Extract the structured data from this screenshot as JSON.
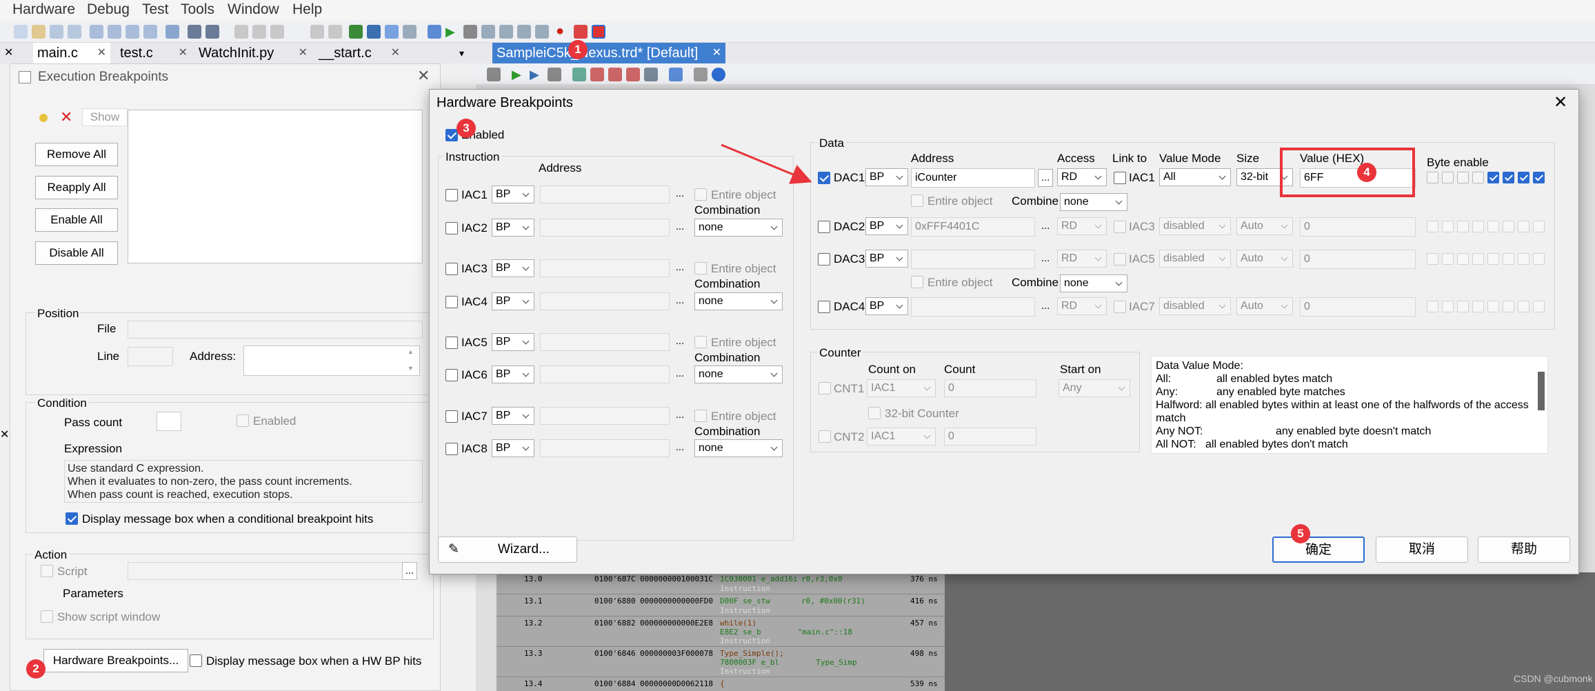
{
  "menu": [
    "Hardware",
    "Debug",
    "Test",
    "Tools",
    "Window",
    "Help"
  ],
  "tabs": [
    {
      "label": "main.c"
    },
    {
      "label": "test.c"
    },
    {
      "label": "WatchInit.py"
    },
    {
      "label": "__start.c"
    }
  ],
  "right_tab": "SampleiC5k_Nexus.trd* [Default]",
  "exec": {
    "title": "Execution Breakpoints",
    "show": "Show",
    "remove_all": "Remove All",
    "reapply_all": "Reapply All",
    "enable_all": "Enable All",
    "disable_all": "Disable All",
    "position": "Position",
    "file": "File",
    "line": "Line",
    "address": "Address:",
    "condition": "Condition",
    "pass_count": "Pass count",
    "enabled": "Enabled",
    "expression": "Expression",
    "expr_help": [
      "Use standard C expression.",
      "When it evaluates to non-zero, the pass count increments.",
      "When pass count is reached, execution stops."
    ],
    "display_msg": "Display message box when a conditional breakpoint hits",
    "action": "Action",
    "script": "Script",
    "parameters": "Parameters",
    "show_script": "Show script window",
    "hw_button": "Hardware Breakpoints...",
    "hw_msg": "Display message box when a HW BP hits"
  },
  "hw": {
    "title": "Hardware Breakpoints",
    "enabled": "Enabled",
    "instruction": "Instruction",
    "address": "Address",
    "iac": [
      {
        "name": "IAC1",
        "type": "BP"
      },
      {
        "name": "IAC2",
        "type": "BP"
      },
      {
        "name": "IAC3",
        "type": "BP"
      },
      {
        "name": "IAC4",
        "type": "BP"
      },
      {
        "name": "IAC5",
        "type": "BP"
      },
      {
        "name": "IAC6",
        "type": "BP"
      },
      {
        "name": "IAC7",
        "type": "BP"
      },
      {
        "name": "IAC8",
        "type": "BP"
      }
    ],
    "entire_object": "Entire object",
    "combination": "Combination",
    "none": "none",
    "data": "Data",
    "data_address": "Address",
    "access": "Access",
    "link_to": "Link to",
    "value_mode": "Value Mode",
    "size": "Size",
    "value_hex": "Value (HEX)",
    "byte_enable": "Byte enable",
    "combine": "Combine",
    "dac": [
      {
        "name": "DAC1",
        "type": "BP",
        "address": "iCounter",
        "access": "RD",
        "link": "IAC1",
        "mode": "All",
        "size": "32-bit",
        "value": "6FF"
      },
      {
        "name": "DAC2",
        "type": "BP",
        "address": "0xFFF4401C",
        "access": "RD",
        "link": "IAC3",
        "mode": "disabled",
        "size": "Auto",
        "value": "0"
      },
      {
        "name": "DAC3",
        "type": "BP",
        "address": "",
        "access": "RD",
        "link": "IAC5",
        "mode": "disabled",
        "size": "Auto",
        "value": "0"
      },
      {
        "name": "DAC4",
        "type": "BP",
        "address": "",
        "access": "RD",
        "link": "IAC7",
        "mode": "disabled",
        "size": "Auto",
        "value": "0"
      }
    ],
    "counter": "Counter",
    "count_on": "Count on",
    "count": "Count",
    "start_on": "Start on",
    "cnt": [
      {
        "name": "CNT1",
        "on": "IAC1",
        "count": "0",
        "start": "Any"
      },
      {
        "name": "CNT2",
        "on": "IAC1",
        "count": "0"
      }
    ],
    "counter32": "32-bit Counter",
    "info": [
      {
        "k": "Data Value Mode:",
        "v": ""
      },
      {
        "k": "All:",
        "v": "all enabled bytes match"
      },
      {
        "k": "Any:",
        "v": "any enabled byte matches"
      },
      {
        "k": "Halfword:",
        "v": "all enabled bytes within at least one of the halfwords of the access match"
      },
      {
        "k": "Any NOT:",
        "v": "any enabled byte doesn't match"
      },
      {
        "k": "All NOT:",
        "v": "all enabled bytes don't match"
      }
    ],
    "wizard": "Wizard...",
    "ok": "确定",
    "cancel": "取消",
    "help": "帮助"
  },
  "trace": [
    {
      "t": "13.0",
      "a": "0100'687C",
      "d": "000000000100031C",
      "s1": "1C030001 e_add16i",
      "s2": "r0,r3,0x0",
      "s3": "Instruction",
      "ns": "376 ns"
    },
    {
      "t": "13.1",
      "a": "0100'6880",
      "d": "0000000000000FD0",
      "s1": "D00F se_stw",
      "s2": "r0, #0x00(r31)",
      "s3": "Instruction",
      "ns": "416 ns"
    },
    {
      "t": "13.2",
      "a": "0100'6882",
      "d": "000000000000E2E8",
      "s1": "while(1)",
      "s2": "",
      "s3": "E8E2 se_b        \"main.c\"::18",
      "s4": "Instruction",
      "ns": "457 ns"
    },
    {
      "t": "13.3",
      "a": "0100'6846",
      "d": "000000003F000078",
      "s1": "Type_Simple();",
      "s2": "",
      "s3": "7800003F e_bl        Type_Simp",
      "s4": "Instruction",
      "ns": "498 ns"
    },
    {
      "t": "13.4",
      "a": "0100'6884",
      "d": "00000000D0062118",
      "s1": "{",
      "s2": "",
      "s3": "",
      "ns": "539 ns"
    }
  ],
  "markers": [
    "1",
    "2",
    "3",
    "4",
    "5"
  ],
  "watermark": "CSDN @cubmonk"
}
